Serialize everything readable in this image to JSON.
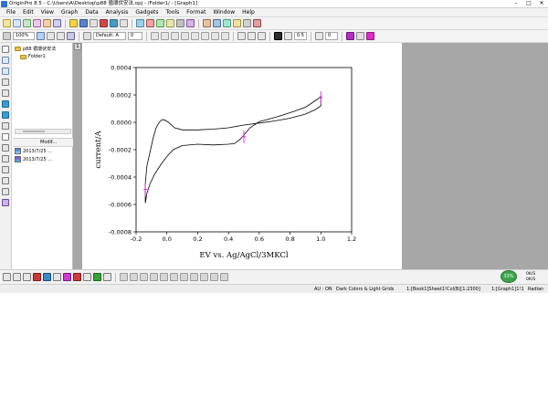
{
  "window": {
    "title": "OriginPro 8.5 - C:\\Users\\A\\Desktop\\p88 循環伏安法.opj - /Folder1/ - [Graph1]",
    "controls": [
      "–",
      "□",
      "✕"
    ]
  },
  "menu": [
    "File",
    "Edit",
    "View",
    "Graph",
    "Data",
    "Analysis",
    "Gadgets",
    "Tools",
    "Format",
    "Window",
    "Help"
  ],
  "toolbar2": {
    "zoom": "100%",
    "font_name": "Default: A",
    "font_size": "0",
    "line_width": "0.5",
    "symbol_size": "0"
  },
  "explorer": {
    "project": "p88 循環伏安法",
    "folder": "Folder1",
    "list_header": "Modif...",
    "rows": [
      {
        "date": "2013/7/25 ..."
      },
      {
        "date": "2013/7/25 ..."
      }
    ]
  },
  "workspace": {
    "tab_number": "1"
  },
  "status": {
    "au": "AU : ON",
    "theme": "Dark Colors & Light Grids",
    "col": "1:[Book1]Sheet1!Col(B)[1:2300]",
    "graph": "1:[Graph1]1!1",
    "radian": "Radian"
  },
  "tray": {
    "gauge": "33%",
    "l1": "0K/S",
    "l2": "0K/S"
  },
  "chart_data": {
    "type": "line",
    "xlabel": "EV vs. Ag/AgCl/3MKCl",
    "ylabel": "current/A",
    "xlim": [
      -0.2,
      1.2
    ],
    "ylim": [
      -0.0008,
      0.0004
    ],
    "xticks": [
      "-0.2",
      "0.0",
      "0.2",
      "0.4",
      "0.6",
      "0.8",
      "1.0",
      "1.2"
    ],
    "yticks": [
      "-0.0008",
      "-0.0006",
      "-0.0004",
      "-0.0002",
      "0.0000",
      "0.0002",
      "0.0004"
    ],
    "line_color": "#000000",
    "marker_color": "#e020e0",
    "curve": [
      [
        -0.14,
        -0.00059
      ],
      [
        -0.14,
        -0.00045
      ],
      [
        -0.13,
        -0.00032
      ],
      [
        -0.11,
        -0.00022
      ],
      [
        -0.09,
        -0.00012
      ],
      [
        -0.07,
        -4e-05
      ],
      [
        -0.05,
        0.0
      ],
      [
        -0.03,
        2e-05
      ],
      [
        -0.01,
        1.5e-05
      ],
      [
        0.01,
        0.0
      ],
      [
        0.05,
        -4e-05
      ],
      [
        0.1,
        -5.5e-05
      ],
      [
        0.2,
        -5.5e-05
      ],
      [
        0.3,
        -5e-05
      ],
      [
        0.4,
        -4e-05
      ],
      [
        0.5,
        -2e-05
      ],
      [
        0.6,
        -5e-06
      ],
      [
        0.7,
        1e-05
      ],
      [
        0.8,
        3e-05
      ],
      [
        0.9,
        6e-05
      ],
      [
        0.96,
        9e-05
      ],
      [
        1.0,
        0.00012
      ],
      [
        1.0,
        0.00019
      ],
      [
        0.98,
        0.00017
      ],
      [
        0.9,
        0.00011
      ],
      [
        0.8,
        7e-05
      ],
      [
        0.7,
        3.5e-05
      ],
      [
        0.6,
        5e-06
      ],
      [
        0.54,
        -4e-05
      ],
      [
        0.51,
        -8e-05
      ],
      [
        0.48,
        -0.00012
      ],
      [
        0.44,
        -0.000155
      ],
      [
        0.4,
        -0.00016
      ],
      [
        0.3,
        -0.000165
      ],
      [
        0.2,
        -0.00016
      ],
      [
        0.1,
        -0.00017
      ],
      [
        0.04,
        -0.0002
      ],
      [
        0.0,
        -0.00025
      ],
      [
        -0.04,
        -0.00031
      ],
      [
        -0.08,
        -0.00038
      ],
      [
        -0.11,
        -0.00045
      ],
      [
        -0.13,
        -0.00052
      ],
      [
        -0.14,
        -0.00059
      ]
    ],
    "error_markers": [
      [
        -0.14,
        -0.00049
      ],
      [
        0.5,
        -0.000105
      ],
      [
        1.0,
        0.00018
      ]
    ]
  }
}
